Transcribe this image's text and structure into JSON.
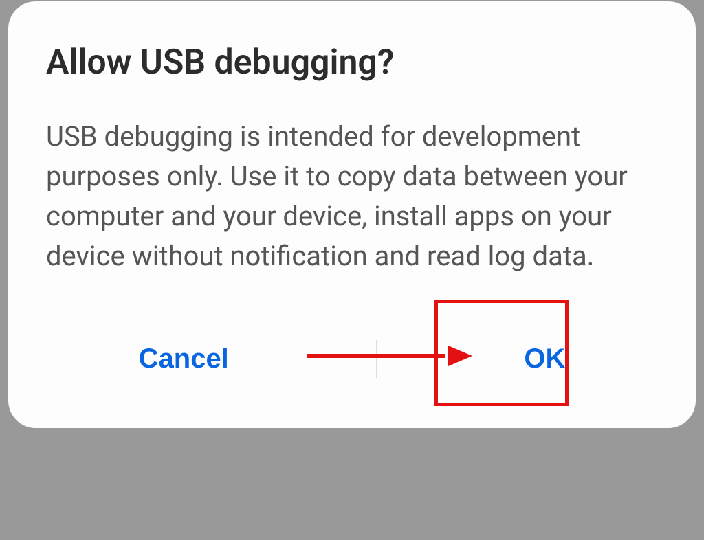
{
  "dialog": {
    "title": "Allow USB debugging?",
    "message": "USB debugging is intended for development purposes only. Use it to copy data between your computer and your device, install apps on your device without notification and read log data.",
    "cancel_label": "Cancel",
    "ok_label": "OK"
  },
  "annotation": {
    "highlight_color": "#e31111",
    "arrow_target": "ok-button"
  }
}
